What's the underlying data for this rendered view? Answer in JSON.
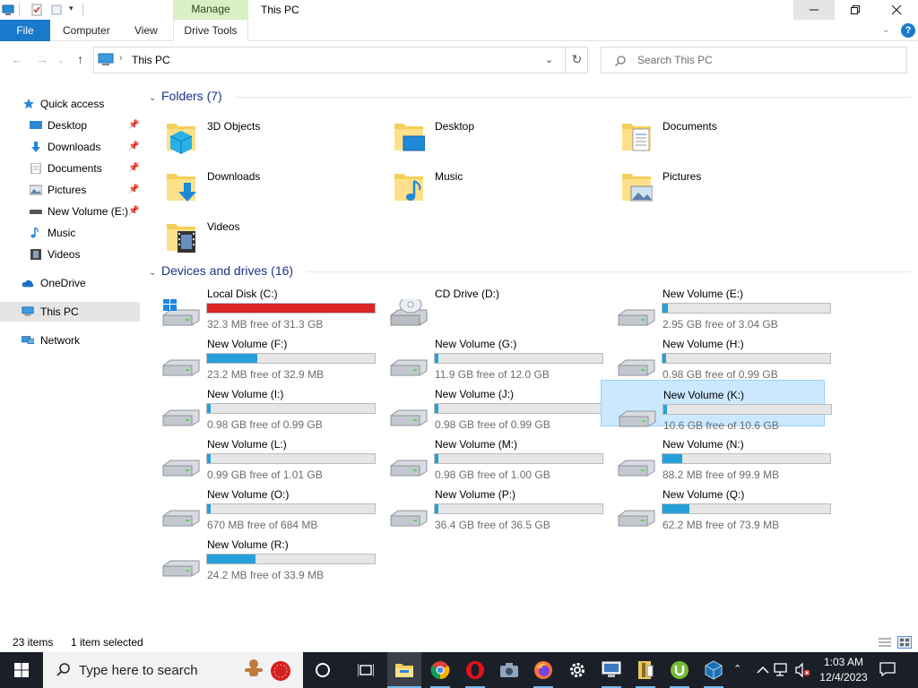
{
  "titlebar": {
    "manage_tab": "Manage",
    "title": "This PC"
  },
  "ribbon": {
    "tabs": [
      "File",
      "Computer",
      "View",
      "Drive Tools"
    ]
  },
  "address": {
    "path": "This PC",
    "search_placeholder": "Search This PC"
  },
  "sidebar": {
    "items": [
      {
        "label": "Quick access",
        "icon": "star-icon"
      },
      {
        "label": "Desktop",
        "icon": "desktop-icon",
        "pinned": true
      },
      {
        "label": "Downloads",
        "icon": "download-arrow-icon",
        "pinned": true
      },
      {
        "label": "Documents",
        "icon": "document-icon",
        "pinned": true
      },
      {
        "label": "Pictures",
        "icon": "picture-icon",
        "pinned": true
      },
      {
        "label": "New Volume (E:)",
        "icon": "drive-icon",
        "pinned": true
      },
      {
        "label": "Music",
        "icon": "music-note-icon"
      },
      {
        "label": "Videos",
        "icon": "film-icon"
      },
      {
        "label": "OneDrive",
        "icon": "cloud-icon"
      },
      {
        "label": "This PC",
        "icon": "computer-icon",
        "selected": true
      },
      {
        "label": "Network",
        "icon": "network-icon"
      }
    ]
  },
  "folders_group": {
    "header": "Folders (7)",
    "items": [
      {
        "label": "3D Objects",
        "icon": "3d-objects-folder-icon"
      },
      {
        "label": "Desktop",
        "icon": "desktop-folder-icon"
      },
      {
        "label": "Documents",
        "icon": "documents-folder-icon"
      },
      {
        "label": "Downloads",
        "icon": "downloads-folder-icon"
      },
      {
        "label": "Music",
        "icon": "music-folder-icon"
      },
      {
        "label": "Pictures",
        "icon": "pictures-folder-icon"
      },
      {
        "label": "Videos",
        "icon": "videos-folder-icon"
      }
    ]
  },
  "drives_group": {
    "header": "Devices and drives (16)",
    "items": [
      {
        "name": "Local Disk (C:)",
        "free": "32.3 MB free of 31.3 GB",
        "used_pct": 100,
        "status_color": "#da2626",
        "icon": "windows-drive-icon"
      },
      {
        "name": "CD Drive (D:)",
        "free": "",
        "used_pct": null,
        "icon": "cd-drive-icon"
      },
      {
        "name": "New Volume (E:)",
        "free": "2.95 GB free of 3.04 GB",
        "used_pct": 3,
        "icon": "drive-icon"
      },
      {
        "name": "New Volume (F:)",
        "free": "23.2 MB free of 32.9 MB",
        "used_pct": 30,
        "icon": "drive-icon"
      },
      {
        "name": "New Volume (G:)",
        "free": "11.9 GB free of 12.0 GB",
        "used_pct": 1,
        "icon": "drive-icon"
      },
      {
        "name": "New Volume (H:)",
        "free": "0.98 GB free of 0.99 GB",
        "used_pct": 1,
        "icon": "drive-icon"
      },
      {
        "name": "New Volume (I:)",
        "free": "0.98 GB free of 0.99 GB",
        "used_pct": 1,
        "icon": "drive-icon"
      },
      {
        "name": "New Volume (J:)",
        "free": "0.98 GB free of 0.99 GB",
        "used_pct": 1,
        "icon": "drive-icon"
      },
      {
        "name": "New Volume (K:)",
        "free": "10.6 GB free of 10.6 GB",
        "used_pct": 0,
        "icon": "drive-icon",
        "selected": true
      },
      {
        "name": "New Volume (L:)",
        "free": "0.99 GB free of 1.01 GB",
        "used_pct": 1,
        "icon": "drive-icon"
      },
      {
        "name": "New Volume (M:)",
        "free": "0.98 GB free of 1.00 GB",
        "used_pct": 1,
        "icon": "drive-icon"
      },
      {
        "name": "New Volume (N:)",
        "free": "88.2 MB free of 99.9 MB",
        "used_pct": 12,
        "icon": "drive-icon"
      },
      {
        "name": "New Volume (O:)",
        "free": "670 MB free of 684 MB",
        "used_pct": 2,
        "icon": "drive-icon"
      },
      {
        "name": "New Volume (P:)",
        "free": "36.4 GB free of 36.5 GB",
        "used_pct": 1,
        "icon": "drive-icon"
      },
      {
        "name": "New Volume (Q:)",
        "free": "62.2 MB free of 73.9 MB",
        "used_pct": 16,
        "icon": "drive-icon"
      },
      {
        "name": "New Volume (R:)",
        "free": "24.2 MB free of 33.9 MB",
        "used_pct": 29,
        "icon": "drive-icon"
      }
    ]
  },
  "status": {
    "items": "23 items",
    "selected": "1 item selected"
  },
  "taskbar": {
    "search_placeholder": "Type here to search",
    "time": "1:03 AM",
    "date": "12/4/2023",
    "apps": [
      "file-explorer-icon",
      "chrome-icon",
      "opera-icon",
      "camera-icon",
      "firefox-icon",
      "settings-gear-icon",
      "remote-desktop-icon",
      "archive-icon",
      "utorrent-icon",
      "virtualbox-icon"
    ]
  }
}
